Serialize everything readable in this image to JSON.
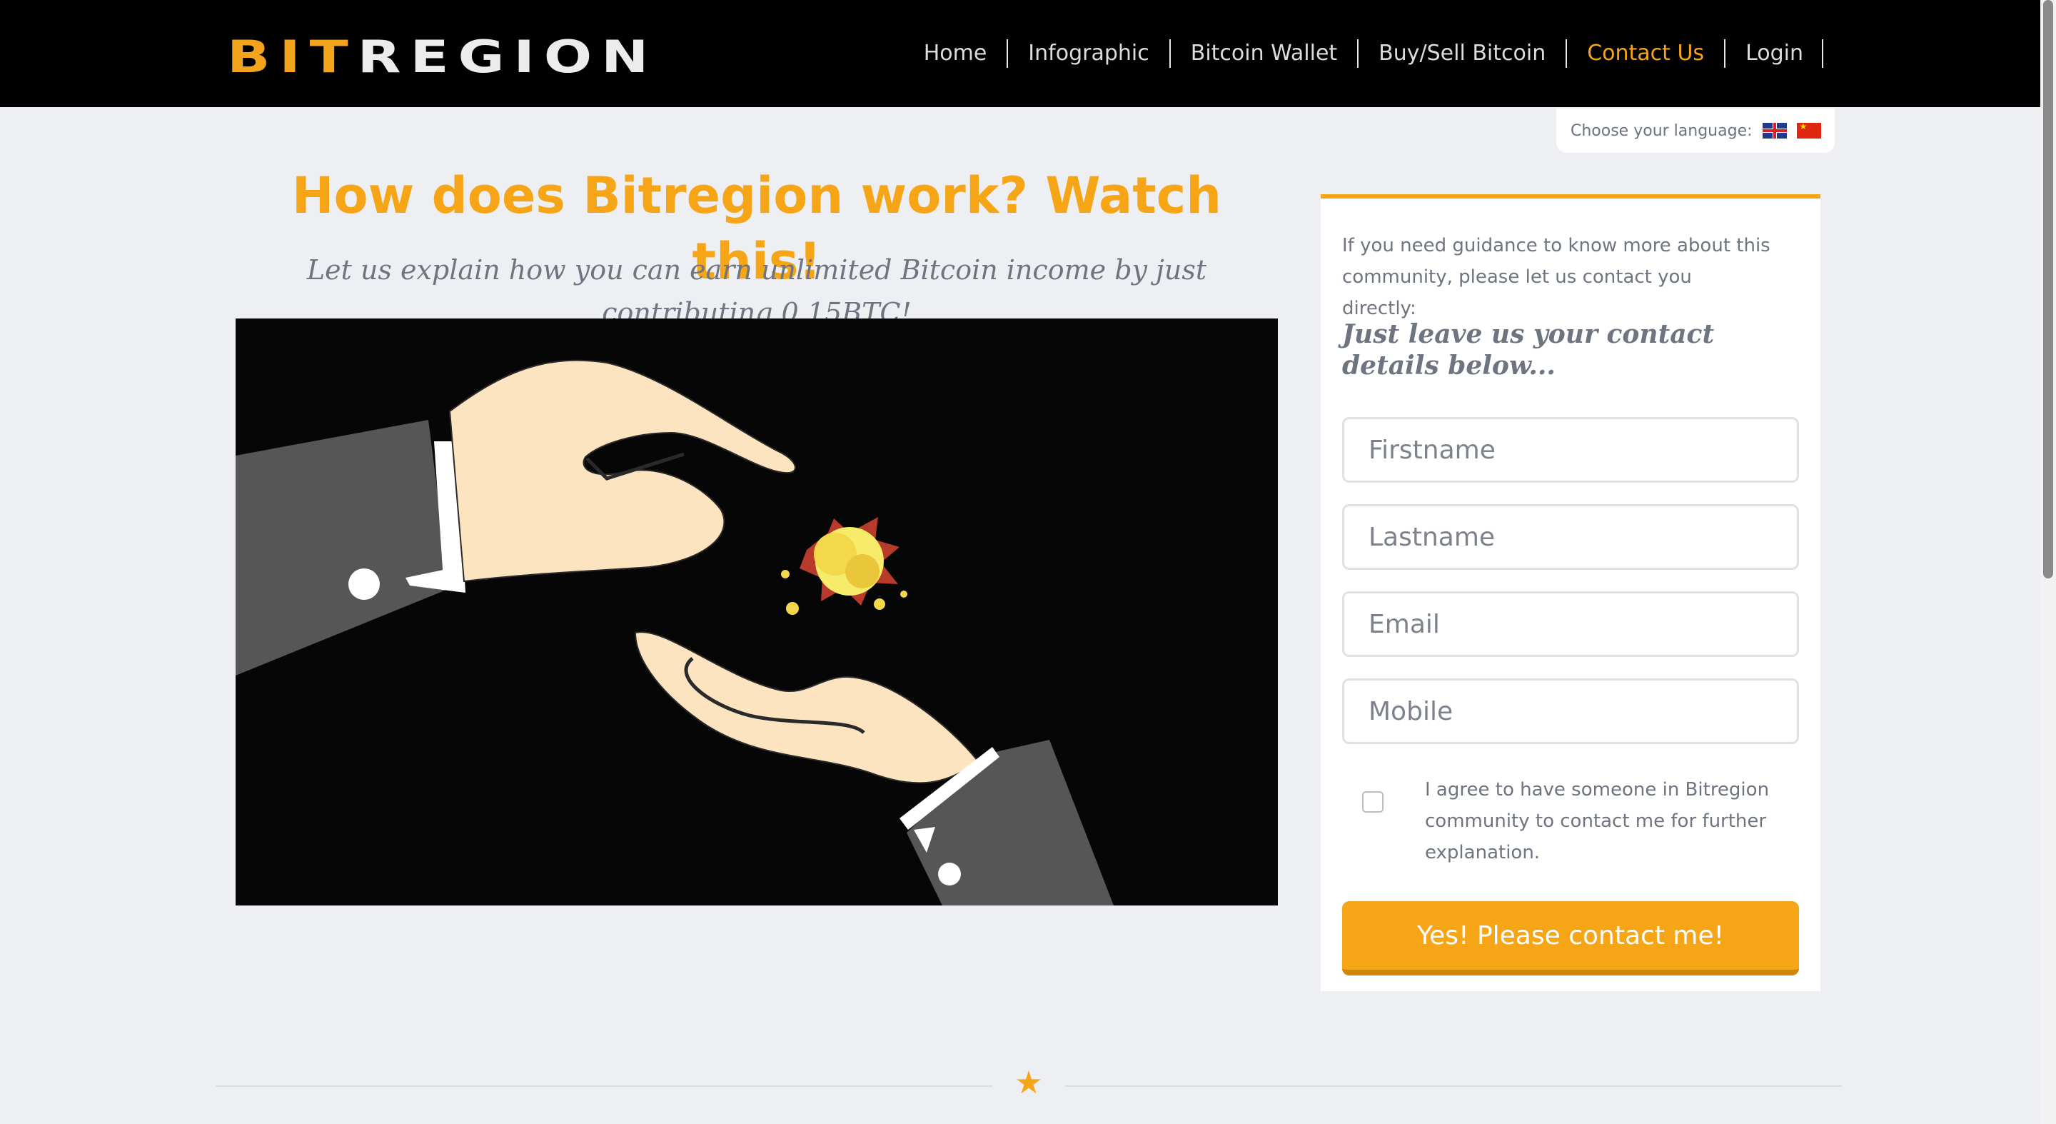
{
  "brand": {
    "logo_part1": "BIT",
    "logo_part2": "REGION",
    "accent_color": "#f6a516"
  },
  "nav": {
    "items": [
      {
        "label": "Home"
      },
      {
        "label": "Infographic"
      },
      {
        "label": "Bitcoin Wallet"
      },
      {
        "label": "Buy/Sell Bitcoin"
      },
      {
        "label": "Contact Us",
        "active": true
      },
      {
        "label": "Login"
      }
    ]
  },
  "language": {
    "label": "Choose your language:",
    "options": [
      {
        "icon": "uk-flag-icon"
      },
      {
        "icon": "china-flag-icon"
      }
    ]
  },
  "hero": {
    "title": "How does Bitregion work? Watch this!",
    "subtitle": "Let us explain how you can earn unlimited Bitcoin income by just contributing 0.15BTC!",
    "video_icon": "video-thumbnail-hands-explosion"
  },
  "contact_form": {
    "intro": "If you need guidance to know more about this community, please let us contact you directly:",
    "cta": "Just leave us your contact details below...",
    "firstname_placeholder": "Firstname",
    "lastname_placeholder": "Lastname",
    "email_placeholder": "Email",
    "mobile_placeholder": "Mobile",
    "consent_text": "I agree to have someone in Bitregion community to contact me for further explanation.",
    "consent_checked": false,
    "submit_label": "Yes! Please contact me!"
  },
  "divider": {
    "icon": "star-icon"
  }
}
